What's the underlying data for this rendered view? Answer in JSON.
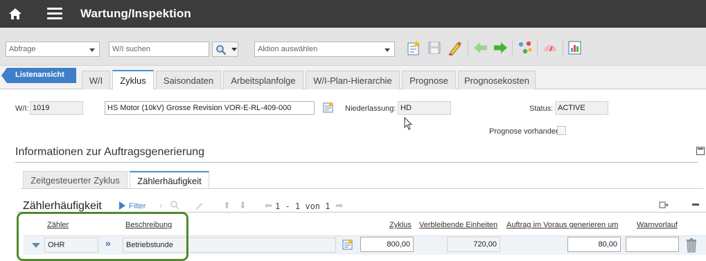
{
  "app": {
    "title": "Wartung/Inspektion"
  },
  "toolbar": {
    "query_select": "Abfrage",
    "search_placeholder": "W/I suchen",
    "action_select": "Aktion auswählen"
  },
  "tabs": {
    "list_view": "Listenansicht",
    "items": [
      "W/I",
      "Zyklus",
      "Saisondaten",
      "Arbeitsplanfolge",
      "W/I-Plan-Hierarchie",
      "Prognose",
      "Prognosekosten"
    ],
    "active": "Zyklus"
  },
  "form": {
    "wi_label": "W/I:",
    "wi_value": "1019",
    "description": "HS Motor (10kV) Grosse Revision VOR-E-RL-409-000",
    "branch_label": "Niederlassung:",
    "branch_value": "HD",
    "status_label": "Status:",
    "status_value": "ACTIVE",
    "forecast_label": "Prognose vorhanden?"
  },
  "section": {
    "title": "Informationen zur Auftragsgenerierung",
    "subtabs": [
      "Zeitgesteuerter Zyklus",
      "Zählerhäufigkeit"
    ],
    "active_subtab": "Zählerhäufigkeit"
  },
  "grid": {
    "title": "Zählerhäufigkeit",
    "filter_label": "Filter",
    "pager": "1 - 1 von 1",
    "headers": {
      "meter": "Zähler",
      "description": "Beschreibung",
      "cycle": "Zyklus",
      "remaining": "Verbleibende Einheiten",
      "advance": "Auftrag im Voraus generieren um",
      "warning": "Warnvorlauf"
    },
    "rows": [
      {
        "meter": "OHR",
        "description": "Betriebstunde",
        "cycle": "800,00",
        "remaining": "720,00",
        "advance": "80,00",
        "warning": ""
      }
    ]
  },
  "colors": {
    "titlebar": "#3c3c3c",
    "accent": "#3f7fc7",
    "highlight": "#4f8a2c"
  }
}
